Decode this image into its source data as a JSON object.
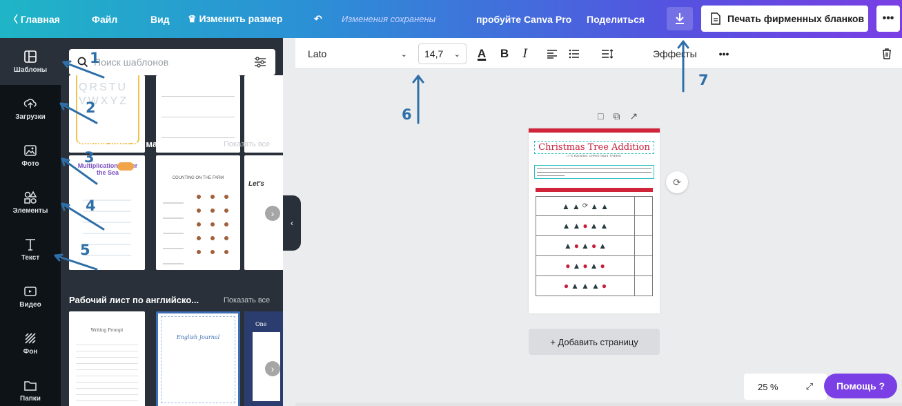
{
  "topbar": {
    "back_label": "〈  Главная",
    "file_label": "Файл",
    "view_label": "Вид",
    "resize_label": "♛ Изменить размер",
    "undo_icon": "undo-icon",
    "saved_status": "Изменения сохранены",
    "pro_label": "пробуйте Canva Pro",
    "share_label": "Поделиться",
    "download_icon": "download-icon",
    "print_label": "Печать фирменных бланков",
    "more_label": "•••"
  },
  "rail": {
    "items": [
      {
        "label": "Шаблоны",
        "icon": "templates-icon"
      },
      {
        "label": "Загрузки",
        "icon": "upload-icon"
      },
      {
        "label": "Фото",
        "icon": "photo-icon"
      },
      {
        "label": "Элементы",
        "icon": "elements-icon"
      },
      {
        "label": "Текст",
        "icon": "text-icon"
      },
      {
        "label": "Видео",
        "icon": "video-icon"
      },
      {
        "label": "Фон",
        "icon": "background-icon"
      },
      {
        "label": "Папки",
        "icon": "folder-icon"
      }
    ]
  },
  "panel": {
    "search_placeholder": "Поиск шаблонов",
    "sections": [
      {
        "title": "Рабочий лист по математике",
        "show_all": "Показать все"
      },
      {
        "title": "Рабочий лист по английско...",
        "show_all": "Показать все"
      }
    ],
    "thumbs": {
      "math1_title": "Multiplication Under the Sea",
      "math2_title": "COUNTING ON THE FARM",
      "math3_title": "Let's",
      "eng1_title": "Writing Prompt",
      "eng2_title": "English Journal",
      "eng3_title": "One",
      "top1_letters": "QRSTU VWXYZ"
    }
  },
  "editor_toolbar": {
    "font": "Lato",
    "font_size": "14,7",
    "color_label": "A",
    "bold_label": "B",
    "italic_label": "I",
    "effects_label": "Эффекты",
    "more_label": "•••"
  },
  "canvas": {
    "ws_title": "Christmas Tree Addition",
    "ws_subtitle": "IT'S RAINING CHRISTMAS TREES!",
    "add_page": "+ Добавить страницу",
    "zoom": "25 %",
    "help": "Помощь  ?"
  },
  "annotations": [
    "1",
    "2",
    "3",
    "4",
    "5",
    "6",
    "7"
  ],
  "colors": {
    "accent": "#7b3fe6",
    "rail": "#0e1318",
    "panel": "#293039",
    "arrow": "#2f6fa8",
    "worksheet_red": "#d0243b"
  }
}
